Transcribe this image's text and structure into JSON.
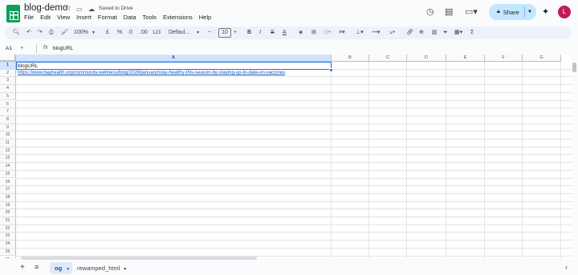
{
  "doc": {
    "title": "blog-demo",
    "saved_status": "Saved to Drive"
  },
  "menu": [
    "File",
    "Edit",
    "View",
    "Insert",
    "Format",
    "Data",
    "Tools",
    "Extensions",
    "Help"
  ],
  "share": {
    "label": "Share"
  },
  "user": {
    "avatar_initial": "L",
    "avatar_color": "#c2185b"
  },
  "toolbar": {
    "zoom": "100%",
    "currency": "£",
    "percent": "%",
    "decrease_decimal": ".0",
    "increase_decimal": ".00",
    "number_format": "123",
    "font": "Defaul...",
    "font_size": "10",
    "minus": "−",
    "plus": "+",
    "bold": "B",
    "italic": "I",
    "strikethrough": "S",
    "text_color": "A"
  },
  "formula_bar": {
    "name_box": "A1",
    "fx": "fx",
    "content": "blogURL"
  },
  "grid": {
    "columns": [
      "A",
      "B",
      "C",
      "D",
      "E",
      "F",
      "G"
    ],
    "rows": [
      "1",
      "2",
      "3",
      "4",
      "5",
      "6",
      "7",
      "8",
      "9",
      "10",
      "11",
      "12",
      "13",
      "14",
      "15",
      "16",
      "17",
      "18",
      "19",
      "20",
      "21",
      "22",
      "23",
      "24",
      "25",
      "26"
    ],
    "selected_cell": "A1",
    "cells": {
      "A1": "blogURL",
      "A2": "https://www.bayhealth.org/community-wellness/blog/2026/january/stay-healthy-this-season-by-staying-up-to-date-on-vaccines"
    }
  },
  "sheets": {
    "tabs": [
      {
        "label": "og",
        "active": true
      },
      {
        "label": "rewamped_html",
        "active": false
      }
    ]
  },
  "colors": {
    "accent": "#1a73e8",
    "share_bg": "#c2e7ff",
    "sheets_green": "#0f9d58",
    "link": "#1155cc"
  }
}
